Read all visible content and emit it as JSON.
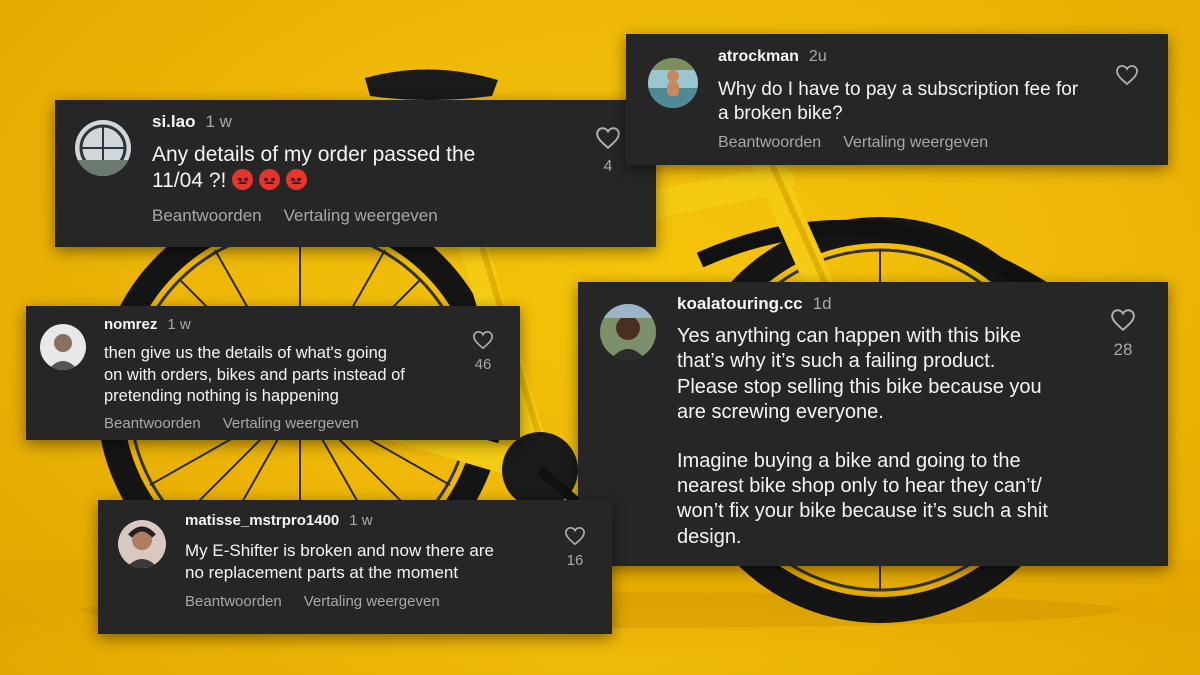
{
  "comments": [
    {
      "username": "si.lao",
      "time": "1 w",
      "lines": [
        "Any details of my order passed the",
        "11/04 ?! "
      ],
      "emoji": [
        "angry-face",
        "angry-face",
        "angry-face"
      ],
      "likes": "4",
      "reply_label": "Beantwoorden",
      "translate_label": "Vertaling weergeven"
    },
    {
      "username": "atrockman",
      "time": "2u",
      "lines": [
        "Why do I have to pay a subscription fee for",
        "a broken bike?"
      ],
      "likes": "",
      "reply_label": "Beantwoorden",
      "translate_label": "Vertaling weergeven"
    },
    {
      "username": "nomrez",
      "time": "1 w",
      "lines": [
        "then give us the details of what's going",
        "on with orders, bikes and parts instead of",
        "pretending nothing is happening"
      ],
      "likes": "46",
      "reply_label": "Beantwoorden",
      "translate_label": "Vertaling weergeven"
    },
    {
      "username": "koalatouring.cc",
      "time": "1d",
      "lines": [
        "Yes anything can happen with this bike",
        "that’s why it’s such a failing product.",
        "Please stop selling this bike because you",
        "are screwing everyone.",
        "",
        "Imagine buying a bike and going to the",
        "nearest bike shop only to hear they can’t/",
        "won’t fix your bike because it’s such a shit",
        "design."
      ],
      "likes": "28"
    },
    {
      "username": "matisse_mstrpro1400",
      "time": "1 w",
      "lines": [
        "My E-Shifter is broken and now there are",
        "no replacement parts at the moment"
      ],
      "likes": "16",
      "reply_label": "Beantwoorden",
      "translate_label": "Vertaling weergeven"
    }
  ],
  "icons": {
    "like": "heart-outline-icon",
    "reaction": "angry-face-emoji"
  },
  "colors": {
    "background": "#f0b908",
    "card": "#262626",
    "text": "#f4f4f4",
    "muted": "#a8a8a8"
  }
}
